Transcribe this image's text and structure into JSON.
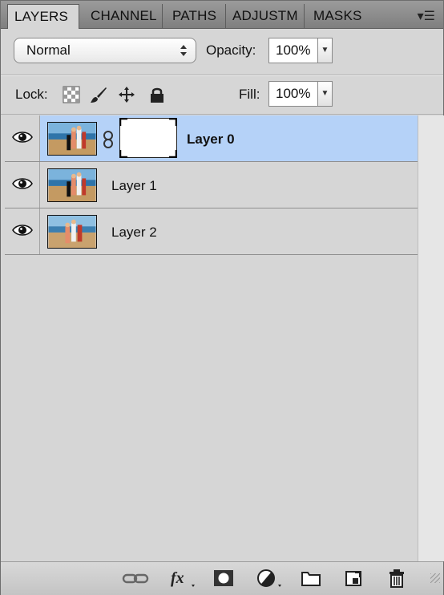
{
  "tabs": [
    "LAYERS",
    "CHANNEL",
    "PATHS",
    "ADJUSTM",
    "MASKS"
  ],
  "panel_menu_icon": "panel-menu-icon",
  "blend_mode": {
    "value": "Normal"
  },
  "opacity": {
    "label": "Opacity:",
    "value": "100%"
  },
  "lock": {
    "label": "Lock:",
    "icons": [
      "lock-transparent-icon",
      "lock-image-icon",
      "lock-position-icon",
      "lock-all-icon"
    ]
  },
  "fill": {
    "label": "Fill:",
    "value": "100%"
  },
  "layers": [
    {
      "name": "Layer 0",
      "selected": true,
      "has_mask": true,
      "bold": true
    },
    {
      "name": "Layer 1",
      "selected": false,
      "has_mask": false,
      "bold": false
    },
    {
      "name": "Layer 2",
      "selected": false,
      "has_mask": false,
      "bold": false
    }
  ],
  "bottom_icons": [
    "link-layers-icon",
    "fx-icon",
    "add-mask-icon",
    "adjustment-layer-icon",
    "new-group-icon",
    "new-layer-icon",
    "trash-icon"
  ],
  "colors": {
    "selection": "#b5d2f8",
    "panel_bg": "#d6d6d6"
  }
}
